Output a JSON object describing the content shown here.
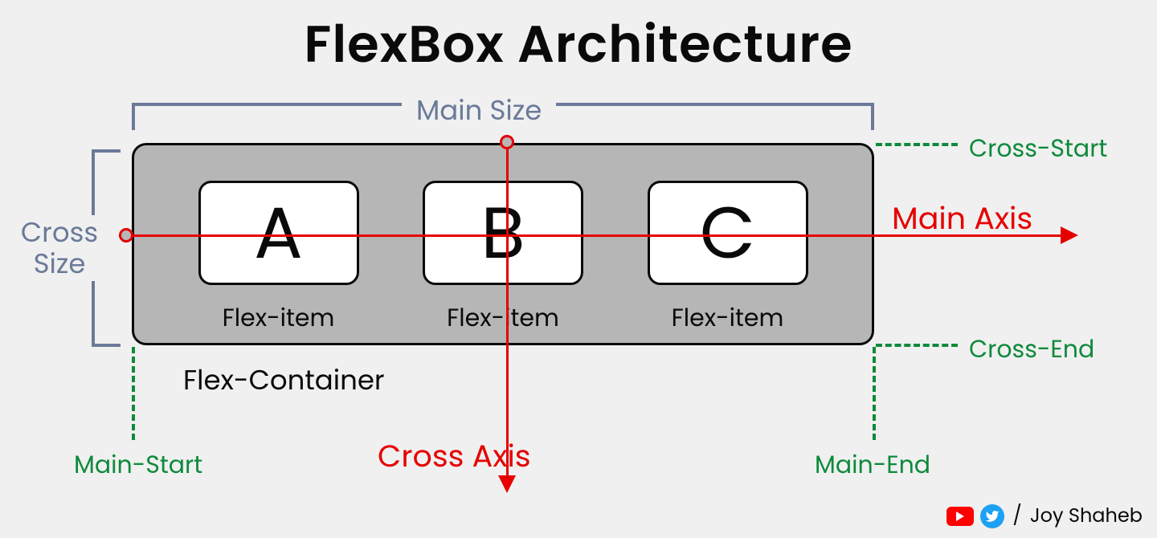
{
  "title": "FlexBox Architecture",
  "main_size_label": "Main Size",
  "cross_size_label": "Cross\nSize",
  "container_label": "Flex-Container",
  "item_caption": "Flex-item",
  "items": {
    "a": "A",
    "b": "B",
    "c": "C"
  },
  "axes": {
    "main": "Main Axis",
    "cross": "Cross Axis"
  },
  "markers": {
    "cross_start": "Cross-Start",
    "cross_end": "Cross-End",
    "main_start": "Main-Start",
    "main_end": "Main-End"
  },
  "credit": {
    "separator": "/",
    "name": "Joy Shaheb"
  },
  "colors": {
    "accent_red": "#e60000",
    "bracket_blue": "#6b7a99",
    "marker_green": "#0e8a3b",
    "container_fill": "#b6b6b6"
  }
}
